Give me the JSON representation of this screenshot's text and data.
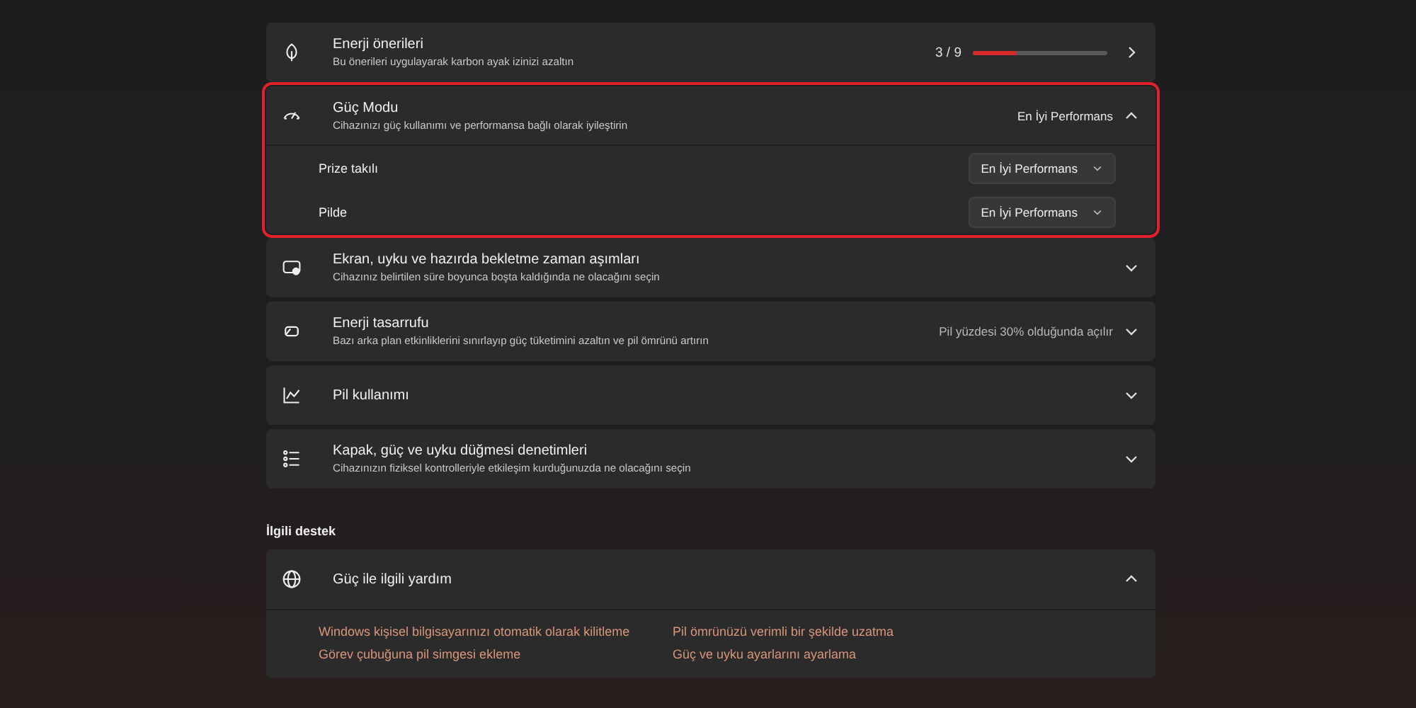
{
  "settings": [
    {
      "kind": "progress",
      "title": "Enerji önerileri",
      "subtitle": "Bu önerileri uygulayarak karbon ayak izinizi azaltın",
      "count": "3 / 9",
      "level": 0.33
    },
    {
      "kind": "expandable",
      "title": "Güç Modu",
      "subtitle": "Cihazınızı güç kullanımı ve performansa bağlı olarak iyileştirin",
      "value": "En İyi Performans",
      "expanded": true,
      "highlighted": true,
      "options": [
        {
          "label": "Prize takılı",
          "value": "En İyi Performans"
        },
        {
          "label": "Pilde",
          "value": "En İyi Performans"
        }
      ]
    },
    {
      "kind": "expandable",
      "title": "Ekran, uyku ve hazırda bekletme zaman aşımları",
      "subtitle": "Cihazınız belirtilen süre boyunca boşta kaldığında ne olacağını seçin",
      "expanded": false
    },
    {
      "kind": "expandable",
      "title": "Enerji tasarrufu",
      "subtitle": "Bazı arka plan etkinliklerini sınırlayıp güç tüketimini azaltın ve pil ömrünü artırın",
      "value": "Pil yüzdesi 30% olduğunda açılır",
      "expanded": false
    },
    {
      "kind": "expandable",
      "title": "Pil kullanımı",
      "expanded": false
    },
    {
      "kind": "expandable",
      "title": "Kapak, güç ve uyku düğmesi denetimleri",
      "subtitle": "Cihazınızın fiziksel kontrolleriyle etkileşim kurduğunuzda ne olacağını seçin",
      "expanded": false
    }
  ],
  "related": {
    "heading": "İlgili destek",
    "title": "Güç ile ilgili yardım",
    "expanded": true,
    "links": [
      "Windows kişisel bilgisayarınızı otomatik olarak kilitleme",
      "Pil ömrünüzü verimli bir şekilde uzatma",
      "Görev çubuğuna pil simgesi ekleme",
      "Güç ve uyku ayarlarını ayarlama"
    ]
  }
}
